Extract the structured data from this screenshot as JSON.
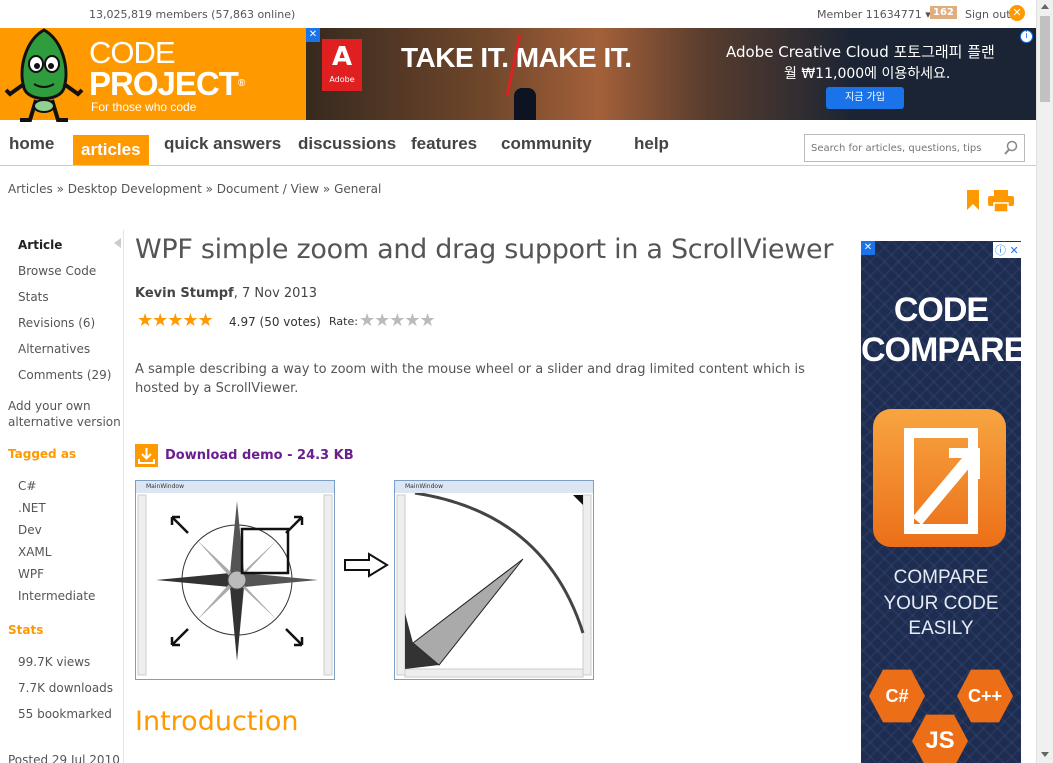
{
  "topbar": {
    "members": "13,025,819 members (57,863 online)",
    "member": "Member 11634771",
    "member_caret": "▾",
    "reputation": "162",
    "signout": "Sign out"
  },
  "logo": {
    "line1": "CODE",
    "line2": "PROJECT",
    "reg": "®",
    "tagline": "For those who code"
  },
  "banner": {
    "close": "✕",
    "adobe_letter": "A",
    "adobe_label": "Adobe",
    "headline_left": "TAKE IT.",
    "headline_right": "MAKE IT.",
    "korean_line1": "Adobe Creative Cloud 포토그래피 플랜",
    "korean_line2": "월 ₩11,000에 이용하세요.",
    "button": "지금 가입",
    "info": "i"
  },
  "nav": {
    "items": [
      "home",
      "articles",
      "quick answers",
      "discussions",
      "features",
      "community",
      "help"
    ],
    "active": "articles"
  },
  "search": {
    "placeholder": "Search for articles, questions, tips"
  },
  "breadcrumb": "Articles » Desktop Development » Document / View » General",
  "sidebar": {
    "items": [
      "Article",
      "Browse Code",
      "Stats",
      "Revisions (6)",
      "Alternatives",
      "Comments (29)"
    ],
    "add_alt_line1": "Add your own",
    "add_alt_line2": "alternative version",
    "tagged_heading": "Tagged as",
    "tags": [
      "C#",
      ".NET",
      "Dev",
      "XAML",
      "WPF",
      "Intermediate"
    ],
    "stats_heading": "Stats",
    "stats": [
      "99.7K views",
      "7.7K downloads",
      "55 bookmarked"
    ],
    "posted": "Posted 29 Jul 2010"
  },
  "article": {
    "title": "WPF simple zoom and drag support in a ScrollViewer",
    "author": "Kevin Stumpf",
    "date": ", 7 Nov 2013",
    "stars": "★★★★★",
    "rating": "4.97 (50 votes)",
    "rate_label": "Rate:",
    "rate_stars": "★★★★★",
    "description": "A sample describing a way to zoom with the mouse wheel or a slider and drag limited content which is hosted by a ScrollViewer.",
    "download": "Download demo - 24.3 KB",
    "window_title": "MainWindow",
    "intro": "Introduction"
  },
  "ad": {
    "close": "✕",
    "info": "ⓘ ✕",
    "title1": "CODE",
    "title2": "COMPARE",
    "sub1": "COMPARE",
    "sub2": "YOUR CODE",
    "sub3": "EASILY",
    "hex1": "C#",
    "hex2": "C++",
    "hex3": "JS"
  },
  "colors": {
    "brand_orange": "#ff9900",
    "link_purple": "#6b1e8e",
    "ad_navy": "#1d2d52"
  }
}
